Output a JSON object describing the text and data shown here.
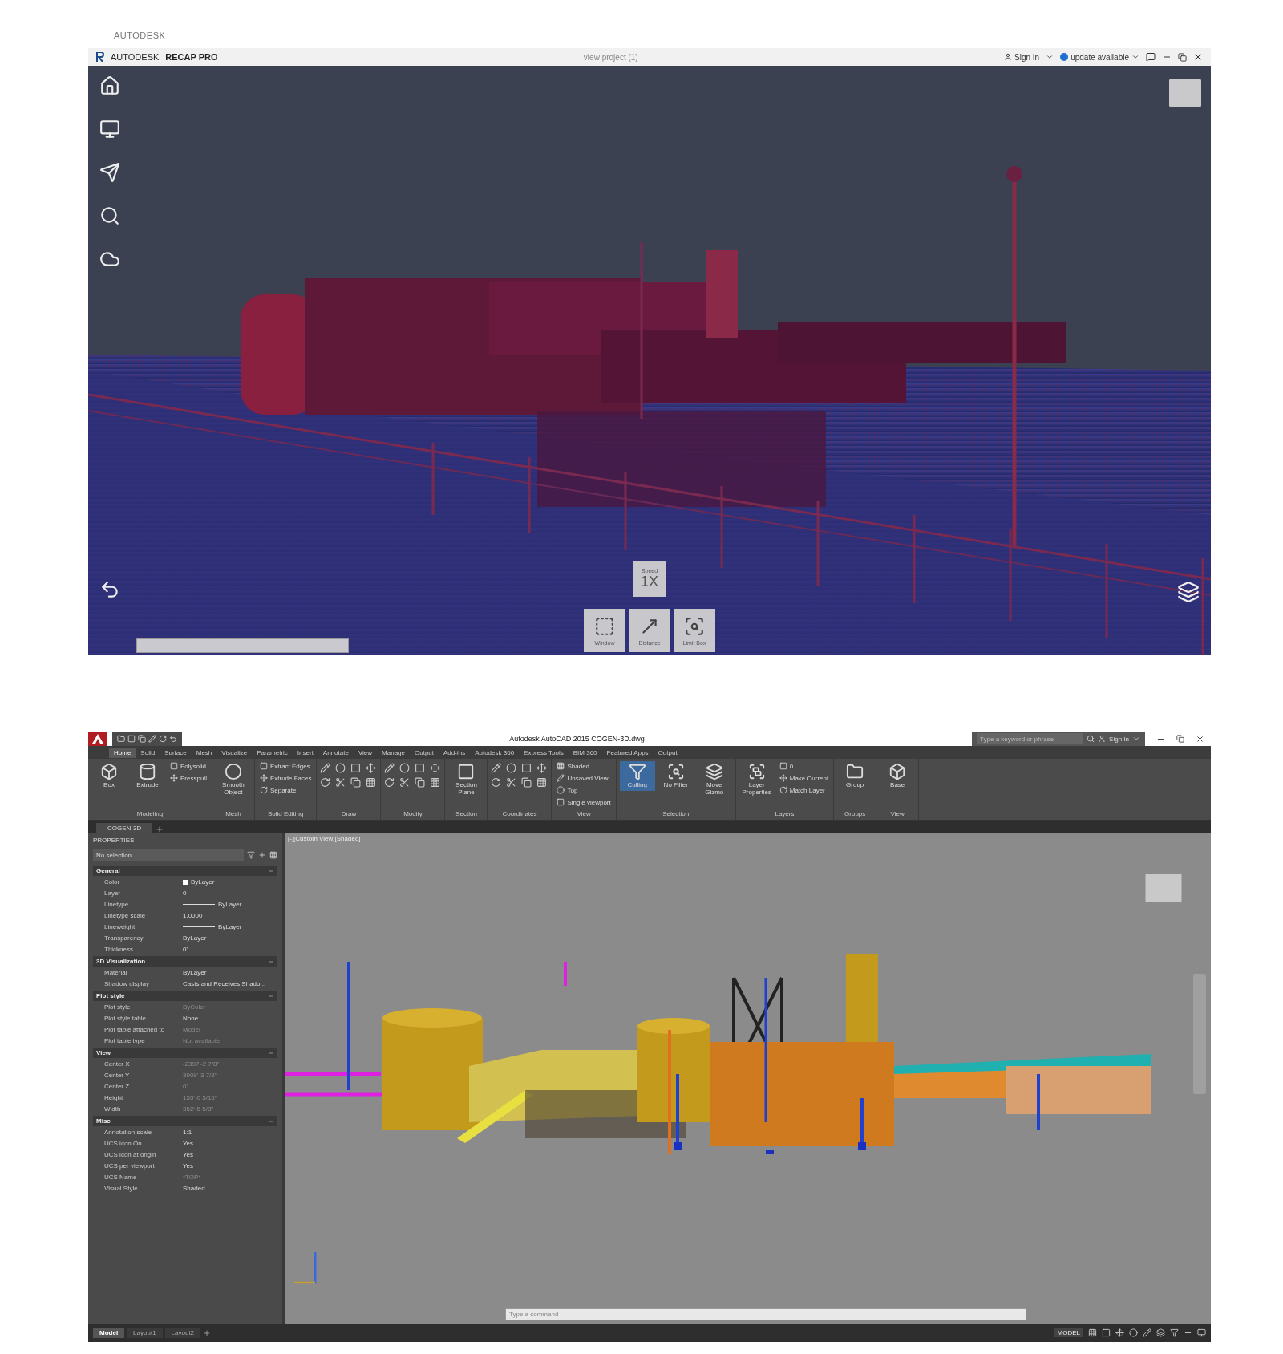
{
  "recap": {
    "ghost_label": "AUTODESK",
    "brand": "AUTODESK",
    "product": "RECAP PRO",
    "project": "view project (1)",
    "sign_in": "Sign In",
    "update": "update available",
    "speed": {
      "label": "Speed",
      "value": "1X"
    },
    "tools": [
      {
        "label": "Window"
      },
      {
        "label": "Distance"
      },
      {
        "label": "Limit Box"
      }
    ]
  },
  "autocad": {
    "title": "Autodesk AutoCAD 2015   COGEN-3D.dwg",
    "search": {
      "placeholder": "Type a keyword or phrase"
    },
    "sign_in": "Sign In",
    "ribbon_tabs": [
      {
        "label": "Home",
        "selected": true
      },
      {
        "label": "Solid",
        "selected": false
      },
      {
        "label": "Surface",
        "selected": false
      },
      {
        "label": "Mesh",
        "selected": false
      },
      {
        "label": "Visualize",
        "selected": false
      },
      {
        "label": "Parametric",
        "selected": false
      },
      {
        "label": "Insert",
        "selected": false
      },
      {
        "label": "Annotate",
        "selected": false
      },
      {
        "label": "View",
        "selected": false
      },
      {
        "label": "Manage",
        "selected": false
      },
      {
        "label": "Output",
        "selected": false
      },
      {
        "label": "Add-ins",
        "selected": false
      },
      {
        "label": "Autodesk 360",
        "selected": false
      },
      {
        "label": "Express Tools",
        "selected": false
      },
      {
        "label": "BIM 360",
        "selected": false
      },
      {
        "label": "Featured Apps",
        "selected": false
      },
      {
        "label": "Output",
        "selected": false
      }
    ],
    "panels": [
      {
        "kind": "buttons",
        "label": "Modeling",
        "buttons": [
          {
            "kind": "large",
            "label": "Box",
            "selected": false
          },
          {
            "kind": "large",
            "label": "Extrude",
            "selected": false
          },
          {
            "kind": "small",
            "label": "Polysolid",
            "selected": false
          },
          {
            "kind": "small",
            "label": "Presspull",
            "selected": false
          }
        ]
      },
      {
        "kind": "buttons",
        "label": "Mesh",
        "buttons": [
          {
            "kind": "large",
            "label": "Smooth Object",
            "selected": false
          }
        ]
      },
      {
        "kind": "buttons",
        "label": "Solid Editing",
        "buttons": [
          {
            "kind": "small",
            "label": "Extract Edges",
            "selected": false
          },
          {
            "kind": "small",
            "label": "Extrude Faces",
            "selected": false
          },
          {
            "kind": "small",
            "label": "Separate",
            "selected": false
          }
        ]
      },
      {
        "kind": "icons",
        "label": "Draw"
      },
      {
        "kind": "icons",
        "label": "Modify"
      },
      {
        "kind": "buttons",
        "label": "Section",
        "buttons": [
          {
            "kind": "large",
            "label": "Section Plane",
            "selected": false
          }
        ]
      },
      {
        "kind": "icons",
        "label": "Coordinates"
      },
      {
        "kind": "buttons",
        "label": "View",
        "buttons": [
          {
            "kind": "small",
            "label": "Shaded",
            "selected": false
          },
          {
            "kind": "small",
            "label": "Unsaved View",
            "selected": false
          },
          {
            "kind": "small",
            "label": "Top",
            "selected": false
          },
          {
            "kind": "small",
            "label": "Single viewport",
            "selected": false
          }
        ]
      },
      {
        "kind": "buttons",
        "label": "Selection",
        "buttons": [
          {
            "kind": "large",
            "label": "Culling",
            "selected": true
          },
          {
            "kind": "large",
            "label": "No Filter",
            "selected": false
          },
          {
            "kind": "large",
            "label": "Move Gizmo",
            "selected": false
          }
        ]
      },
      {
        "kind": "buttons",
        "label": "Layers",
        "buttons": [
          {
            "kind": "large",
            "label": "Layer Properties",
            "selected": false
          },
          {
            "kind": "small",
            "label": "0",
            "selected": false
          },
          {
            "kind": "small",
            "label": "Make Current",
            "selected": false
          },
          {
            "kind": "small",
            "label": "Match Layer",
            "selected": false
          }
        ]
      },
      {
        "kind": "buttons",
        "label": "Groups",
        "buttons": [
          {
            "kind": "large",
            "label": "Group",
            "selected": false
          }
        ]
      },
      {
        "kind": "buttons",
        "label": "View",
        "buttons": [
          {
            "kind": "large",
            "label": "Base",
            "selected": false
          }
        ]
      }
    ],
    "file_tab": "COGEN-3D",
    "properties": {
      "title": "PROPERTIES",
      "selection": "No selection",
      "sections": [
        {
          "title": "General",
          "rows": [
            {
              "kind": "swatch",
              "name": "Color",
              "value": "ByLayer",
              "disabled": false
            },
            {
              "kind": "text",
              "name": "Layer",
              "value": "0",
              "disabled": false
            },
            {
              "kind": "line",
              "name": "Linetype",
              "value": "ByLayer",
              "disabled": false
            },
            {
              "kind": "text",
              "name": "Linetype scale",
              "value": "1.0000",
              "disabled": false
            },
            {
              "kind": "line",
              "name": "Lineweight",
              "value": "ByLayer",
              "disabled": false
            },
            {
              "kind": "text",
              "name": "Transparency",
              "value": "ByLayer",
              "disabled": false
            },
            {
              "kind": "text",
              "name": "Thickness",
              "value": "0\"",
              "disabled": false
            }
          ]
        },
        {
          "title": "3D Visualization",
          "rows": [
            {
              "kind": "text",
              "name": "Material",
              "value": "ByLayer",
              "disabled": false
            },
            {
              "kind": "text",
              "name": "Shadow display",
              "value": "Casts and Receives Shado...",
              "disabled": false
            }
          ]
        },
        {
          "title": "Plot style",
          "rows": [
            {
              "kind": "text",
              "name": "Plot style",
              "value": "ByColor",
              "disabled": true
            },
            {
              "kind": "text",
              "name": "Plot style table",
              "value": "None",
              "disabled": false
            },
            {
              "kind": "text",
              "name": "Plot table attached to",
              "value": "Model",
              "disabled": true
            },
            {
              "kind": "text",
              "name": "Plot table type",
              "value": "Not available",
              "disabled": true
            }
          ]
        },
        {
          "title": "View",
          "rows": [
            {
              "kind": "text",
              "name": "Center X",
              "value": "-2397'-2 7/8\"",
              "disabled": true
            },
            {
              "kind": "text",
              "name": "Center Y",
              "value": "3909'-3 7/8\"",
              "disabled": true
            },
            {
              "kind": "text",
              "name": "Center Z",
              "value": "0\"",
              "disabled": true
            },
            {
              "kind": "text",
              "name": "Height",
              "value": "155'-0 5/16\"",
              "disabled": true
            },
            {
              "kind": "text",
              "name": "Width",
              "value": "352'-5 5/8\"",
              "disabled": true
            }
          ]
        },
        {
          "title": "Misc",
          "rows": [
            {
              "kind": "text",
              "name": "Annotation scale",
              "value": "1:1",
              "disabled": false
            },
            {
              "kind": "text",
              "name": "UCS icon On",
              "value": "Yes",
              "disabled": false
            },
            {
              "kind": "text",
              "name": "UCS icon at origin",
              "value": "Yes",
              "disabled": false
            },
            {
              "kind": "text",
              "name": "UCS per viewport",
              "value": "Yes",
              "disabled": false
            },
            {
              "kind": "text",
              "name": "UCS Name",
              "value": "*TOP*",
              "disabled": true
            },
            {
              "kind": "text",
              "name": "Visual Style",
              "value": "Shaded",
              "disabled": false
            }
          ]
        }
      ]
    },
    "viewport_label": "[-][Custom View][Shaded]",
    "command": {
      "placeholder": "Type a command"
    },
    "layout_tabs": [
      {
        "label": "Model",
        "selected": true
      },
      {
        "label": "Layout1",
        "selected": false
      },
      {
        "label": "Layout2",
        "selected": false
      }
    ],
    "status": "MODEL"
  }
}
